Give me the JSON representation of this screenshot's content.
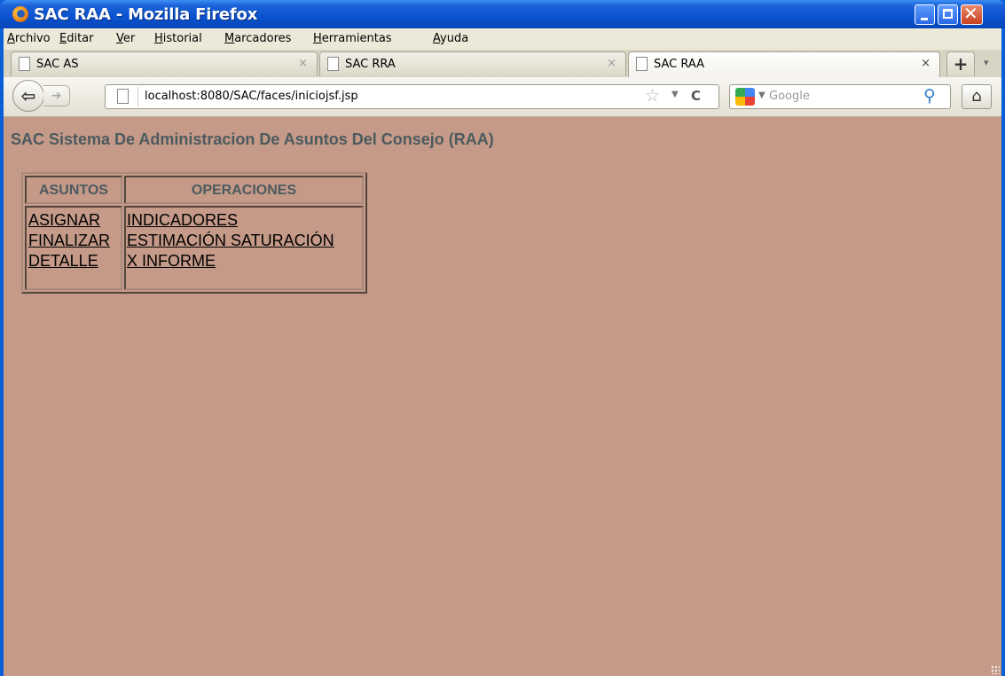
{
  "window": {
    "title": "SAC RAA - Mozilla Firefox"
  },
  "menubar": {
    "items": [
      {
        "underline": "A",
        "rest": "rchivo"
      },
      {
        "underline": "E",
        "rest": "ditar"
      },
      {
        "underline": "V",
        "rest": "er"
      },
      {
        "underline": "H",
        "rest": "istorial"
      },
      {
        "underline": "M",
        "rest": "arcadores"
      },
      {
        "underline": "H",
        "rest": "erramientas"
      },
      {
        "underline": "A",
        "rest": "yuda"
      }
    ]
  },
  "tabs": [
    {
      "label": "SAC AS",
      "active": false
    },
    {
      "label": "SAC RRA",
      "active": false
    },
    {
      "label": "SAC RAA",
      "active": true
    }
  ],
  "tab_close_glyph": "×",
  "new_tab_glyph": "+",
  "navbar": {
    "url": "localhost:8080/SAC/faces/iniciojsf.jsp",
    "search_placeholder": "Google"
  },
  "page": {
    "title": "SAC Sistema De Administracion De Asuntos Del Consejo (RAA)",
    "background": "#c59a89",
    "heading_color": "#4c5a5e",
    "menu_table": {
      "headers": [
        "ASUNTOS",
        "OPERACIONES"
      ],
      "asuntos_links": [
        "ASIGNAR",
        "FINALIZAR",
        "DETALLE"
      ],
      "operaciones_links": [
        "INDICADORES",
        "ESTIMACIÓN SATURACIÓN",
        "X INFORME"
      ]
    }
  }
}
